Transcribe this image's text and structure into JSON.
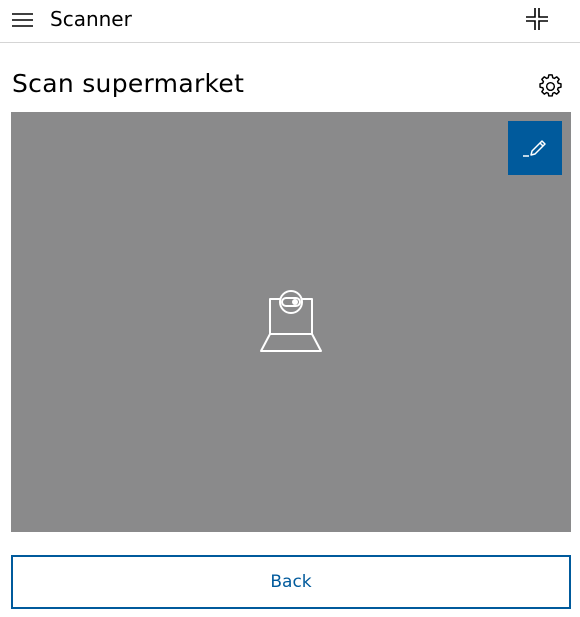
{
  "header": {
    "title": "Scanner",
    "menu_icon": "hamburger-menu-icon",
    "collapse_icon": "minimize-icon"
  },
  "page": {
    "title": "Scan supermarket",
    "settings_icon": "gear-icon"
  },
  "scanner": {
    "edit_icon": "pencil-icon",
    "placeholder_icon": "laptop-webcam-icon",
    "background_color": "#8a8a8b"
  },
  "actions": {
    "back_label": "Back"
  },
  "colors": {
    "accent": "#005a9c"
  }
}
